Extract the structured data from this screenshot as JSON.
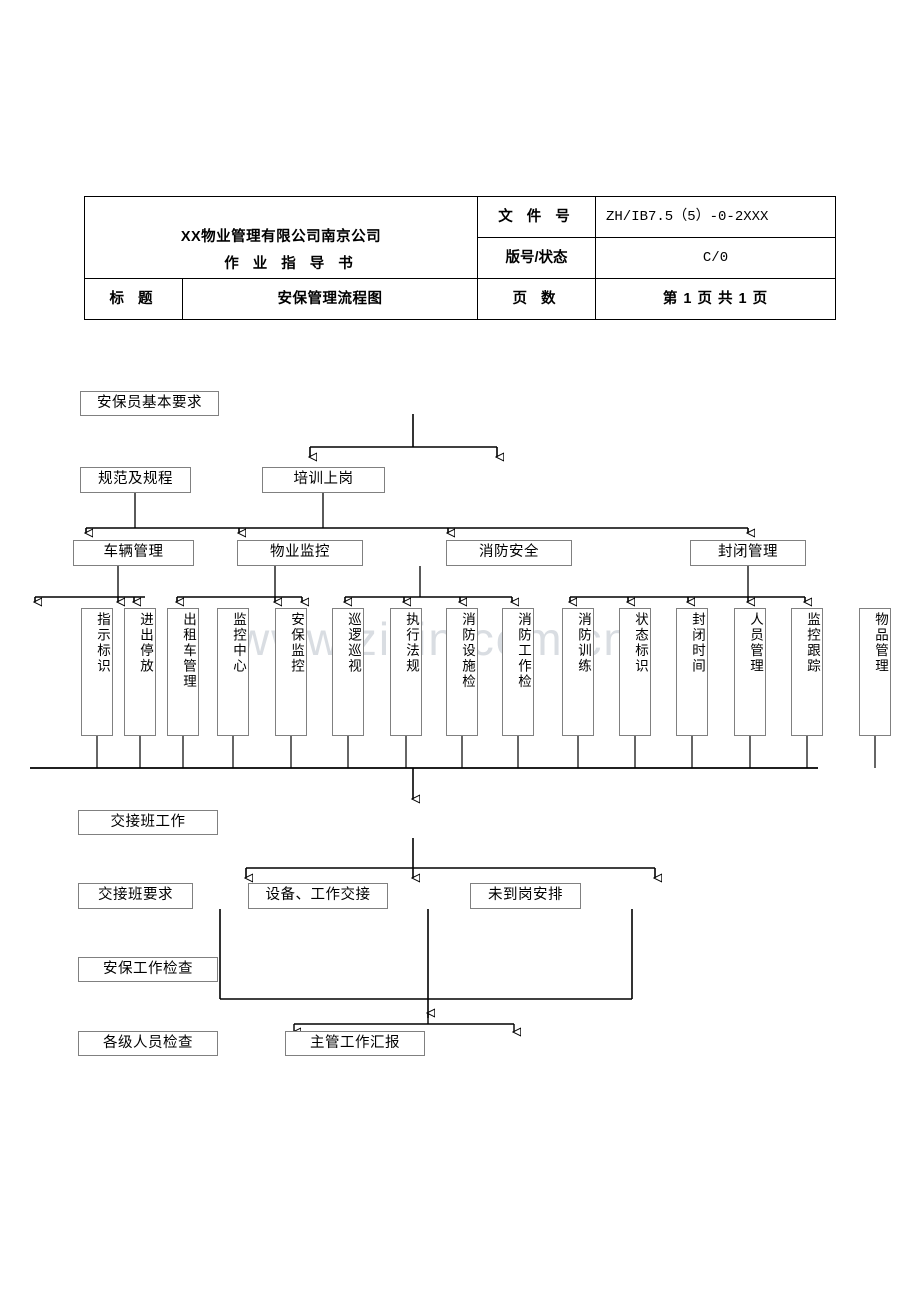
{
  "document_header": {
    "company": "XX物业管理有限公司南京公司",
    "doc_kind": "作 业 指 导 书",
    "title_label": "标    题",
    "title_value": "安保管理流程图",
    "file_no_label": "文 件 号",
    "file_no_value": "ZH/IB7.5（5）-0-2XXX",
    "version_label": "版号/状态",
    "version_value": "C/0",
    "pages_label": "页    数",
    "pages_value": "第 1 页  共 1 页"
  },
  "watermark": "www.zixin.com.cn",
  "flow": {
    "level1": {
      "label": "安保员基本要求"
    },
    "level2": [
      {
        "label": "规范及规程"
      },
      {
        "label": "培训上岗"
      }
    ],
    "level3": [
      {
        "label": "车辆管理"
      },
      {
        "label": "物业监控"
      },
      {
        "label": "消防安全"
      },
      {
        "label": "封闭管理"
      }
    ],
    "level4": [
      {
        "label": "指示标识"
      },
      {
        "label": "进出停放"
      },
      {
        "label": "出租车管理"
      },
      {
        "label": "监控中心"
      },
      {
        "label": "安保监控"
      },
      {
        "label": "巡逻巡视"
      },
      {
        "label": "执行法规"
      },
      {
        "label": "消防设施检"
      },
      {
        "label": "消防工作检"
      },
      {
        "label": "消防训练"
      },
      {
        "label": "状态标识"
      },
      {
        "label": "封闭时间"
      },
      {
        "label": "人员管理"
      },
      {
        "label": "监控跟踪"
      },
      {
        "label": "物品管理"
      }
    ],
    "level5": {
      "label": "交接班工作"
    },
    "level6": [
      {
        "label": "交接班要求"
      },
      {
        "label": "设备、工作交接"
      },
      {
        "label": "未到岗安排"
      }
    ],
    "level7": {
      "label": "安保工作检查"
    },
    "level8": [
      {
        "label": "各级人员检查"
      },
      {
        "label": "主管工作汇报"
      }
    ]
  },
  "colors": {
    "box_border": "#808080",
    "line": "#000000",
    "watermark": "#d9dde2",
    "table_border": "#000000"
  }
}
